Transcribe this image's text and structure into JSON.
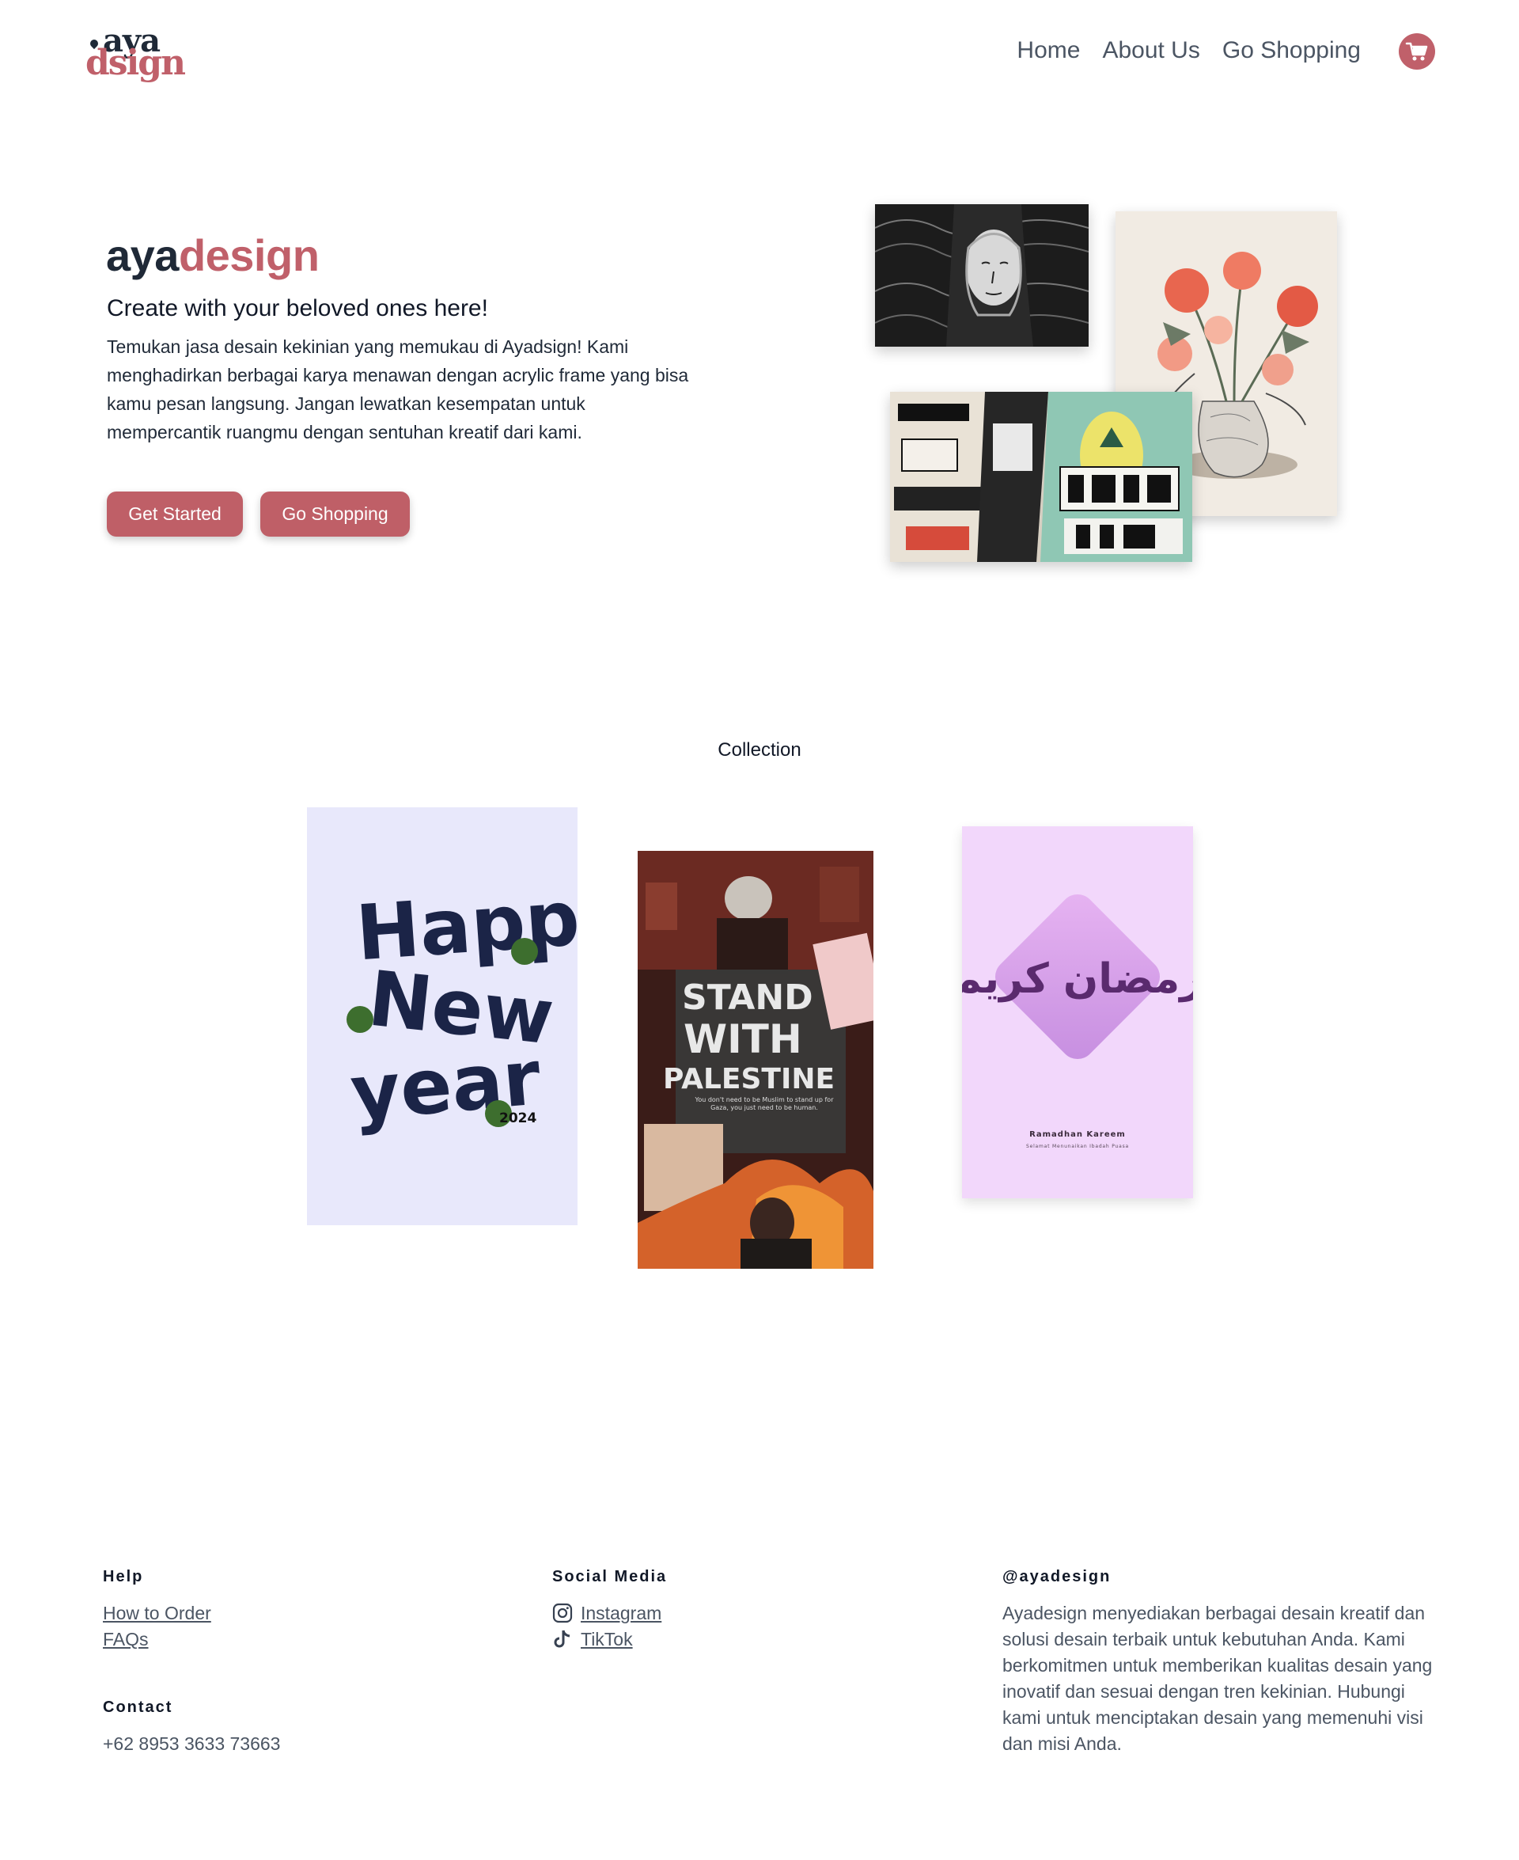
{
  "brand": {
    "logo_top": "aya",
    "logo_bottom": "dsign",
    "primary_color": "#c0606a",
    "dark_color": "#1f2937"
  },
  "nav": {
    "links": [
      "Home",
      "About Us",
      "Go Shopping"
    ],
    "cart_icon": "shopping-cart-icon"
  },
  "hero": {
    "title_part1": "aya",
    "title_part2": "design",
    "subtitle": "Create with your beloved ones here!",
    "description": "Temukan jasa desain kekinian yang memukau di Ayadsign! Kami menghadirkan berbagai karya menawan dengan acrylic frame yang bisa kamu pesan langsung. Jangan lewatkan kesempatan untuk mempercantik ruangmu dengan sentuhan kreatif dari kami.",
    "btn_primary": "Get Started",
    "btn_secondary": "Go Shopping"
  },
  "collection": {
    "title": "Collection",
    "cards": [
      {
        "text_line1": "Happy",
        "text_line2": "New",
        "text_line3": "year",
        "year": "2024"
      },
      {
        "text_line1": "STAND",
        "text_line2": "WITH",
        "text_line3": "PALESTINE",
        "caption": "You don't need to be Muslim to stand up for Gaza, you just need to be human."
      },
      {
        "arabic": "رمضان كريم",
        "title": "Ramadhan Kareem",
        "caption": "Selamat Menunaikan Ibadah Puasa"
      }
    ]
  },
  "footer": {
    "help_heading": "Help",
    "help_links": [
      "How to Order",
      "FAQs"
    ],
    "contact_heading": "Contact",
    "phone": "+62 8953 3633 73663",
    "social_heading": "Social Media",
    "social_links": [
      {
        "label": "Instagram",
        "icon": "instagram-icon"
      },
      {
        "label": "TikTok",
        "icon": "tiktok-icon"
      }
    ],
    "about_heading": "@ayadesign",
    "about_text": "Ayadesign menyediakan berbagai desain kreatif dan solusi desain terbaik untuk kebutuhan Anda. Kami berkomitmen untuk memberikan kualitas desain yang inovatif dan sesuai dengan tren kekinian. Hubungi kami untuk menciptakan desain yang memenuhi visi dan misi Anda."
  }
}
